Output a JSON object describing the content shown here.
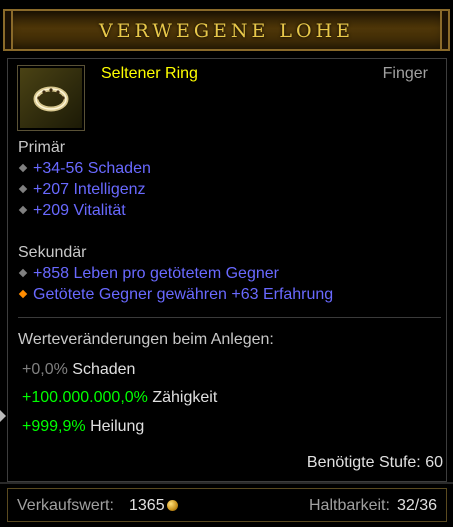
{
  "item": {
    "title": "VERWEGENE LOHE",
    "name": "Seltener Ring",
    "slot": "Finger",
    "icon": "ring-icon"
  },
  "primary": {
    "heading": "Primär",
    "stats": [
      "+34-56 Schaden",
      "+207 Intelligenz",
      "+209 Vitalität"
    ]
  },
  "secondary": {
    "heading": "Sekundär",
    "stats": [
      "+858 Leben pro getötetem Gegner",
      "Getötete Gegner gewähren +63 Erfahrung"
    ]
  },
  "changes": {
    "heading": "Werteveränderungen beim Anlegen:",
    "rows": [
      {
        "value": "+0,0%",
        "label": "Schaden",
        "tone": "neutral"
      },
      {
        "value": "+100.000.000,0%",
        "label": "Zähigkeit",
        "tone": "positive"
      },
      {
        "value": "+999,9%",
        "label": "Heilung",
        "tone": "positive"
      }
    ]
  },
  "requirement": "Benötigte Stufe: 60",
  "footer": {
    "sell_label": "Verkaufswert:",
    "sell_value": "1365",
    "durability_label": "Haltbarkeit:",
    "durability_value": "32/36"
  },
  "colors": {
    "title": "#e8c84a",
    "rare_name": "#ffff00",
    "magic_stat": "#6969ff",
    "positive": "#00ff00",
    "neutral": "#808080"
  }
}
